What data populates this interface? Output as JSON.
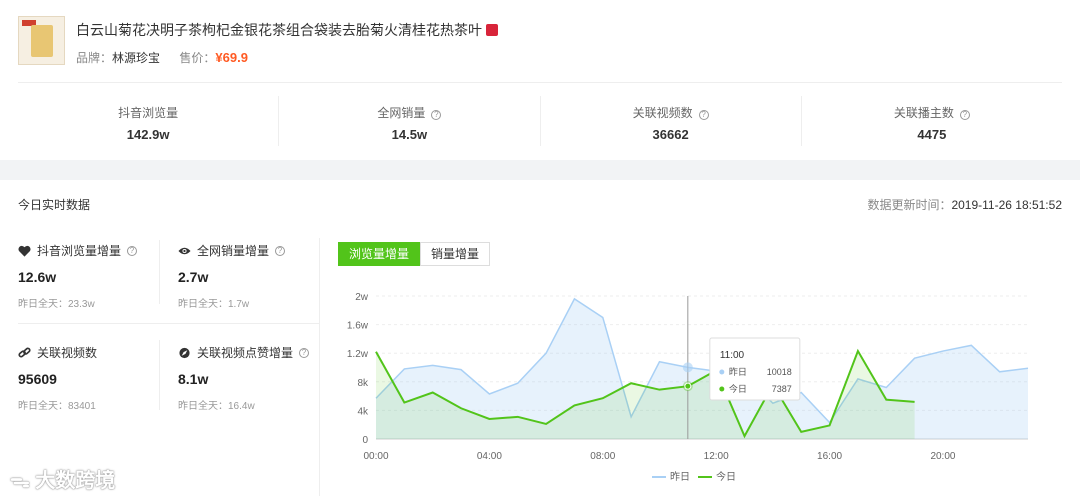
{
  "product": {
    "title": "白云山菊花决明子茶枸杞金银花茶组合袋装去胎菊火清桂花热茶叶",
    "brand_label": "品牌：",
    "brand": "林源珍宝",
    "price_label": "售价：",
    "price": "¥69.9"
  },
  "stats": [
    {
      "label": "抖音浏览量",
      "value": "142.9w",
      "help": false
    },
    {
      "label": "全网销量",
      "value": "14.5w",
      "help": true
    },
    {
      "label": "关联视频数",
      "value": "36662",
      "help": true
    },
    {
      "label": "关联播主数",
      "value": "4475",
      "help": true
    }
  ],
  "realtime": {
    "title": "今日实时数据",
    "update_label": "数据更新时间：",
    "update_time": "2019-11-26 18:51:52",
    "kpis": [
      {
        "label": "抖音浏览量增量",
        "value": "12.6w",
        "sub": "昨日全天：23.3w",
        "icon": "heart-icon"
      },
      {
        "label": "全网销量增量",
        "value": "2.7w",
        "sub": "昨日全天：1.7w",
        "icon": "eye-icon"
      },
      {
        "label": "关联视频数",
        "value": "95609",
        "sub": "昨日全天：83401",
        "icon": "link-icon"
      },
      {
        "label": "关联视频点赞增量",
        "value": "8.1w",
        "sub": "昨日全天：16.4w",
        "icon": "compass-icon"
      }
    ],
    "tabs": [
      "浏览量增量",
      "销量增量"
    ]
  },
  "chart_data": {
    "type": "area",
    "x": [
      "00:00",
      "01:00",
      "02:00",
      "03:00",
      "04:00",
      "05:00",
      "06:00",
      "07:00",
      "08:00",
      "09:00",
      "10:00",
      "11:00",
      "12:00",
      "13:00",
      "14:00",
      "15:00",
      "16:00",
      "17:00",
      "18:00",
      "19:00",
      "20:00",
      "21:00",
      "22:00",
      "23:00"
    ],
    "xticks": [
      "00:00",
      "04:00",
      "08:00",
      "12:00",
      "16:00",
      "20:00"
    ],
    "yticks": [
      "0",
      "4k",
      "8k",
      "1.2w",
      "1.6w",
      "2w"
    ],
    "ylim": [
      0,
      20000
    ],
    "series": [
      {
        "name": "昨日",
        "color": "#a9d0f5",
        "values": [
          5700,
          9800,
          10300,
          9700,
          6300,
          7800,
          12000,
          19600,
          17000,
          3100,
          10800,
          10018,
          9500,
          9000,
          5000,
          6500,
          2300,
          8400,
          7200,
          11300,
          12300,
          13100,
          9400,
          9900
        ]
      },
      {
        "name": "今日",
        "color": "#52c41a",
        "values": [
          12200,
          5100,
          6500,
          4300,
          2800,
          3100,
          2100,
          4700,
          5700,
          7800,
          6900,
          7387,
          9600,
          400,
          7600,
          1000,
          1900,
          12300,
          5500,
          5200
        ]
      }
    ],
    "tooltip": {
      "time": "11:00",
      "rows": [
        {
          "name": "昨日",
          "value": "10018"
        },
        {
          "name": "今日",
          "value": "7387"
        }
      ]
    }
  },
  "watermark": "大数跨境"
}
